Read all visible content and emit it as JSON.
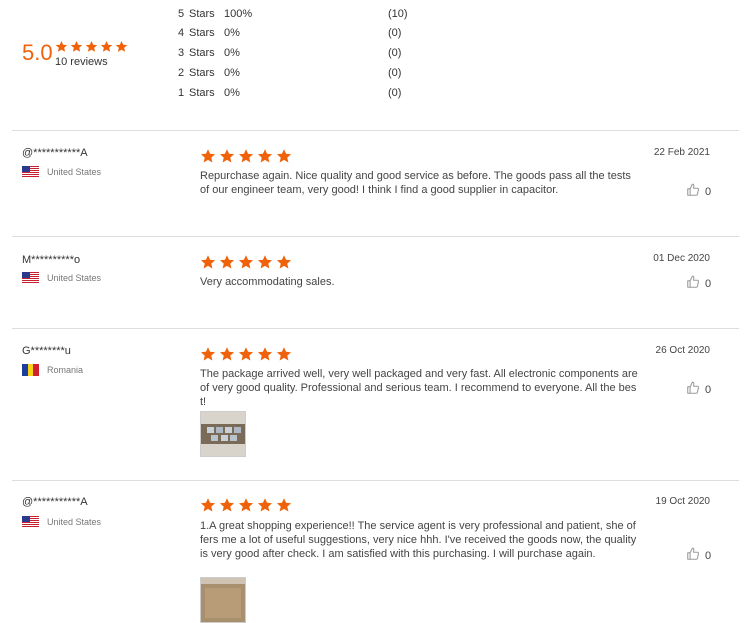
{
  "summary": {
    "average": "5.0",
    "count_label": "10 reviews",
    "histogram": [
      {
        "level": "5",
        "stars_label": "Stars",
        "percent": "100%",
        "count": "(10)"
      },
      {
        "level": "4",
        "stars_label": "Stars",
        "percent": "0%",
        "count": "(0)"
      },
      {
        "level": "3",
        "stars_label": "Stars",
        "percent": "0%",
        "count": "(0)"
      },
      {
        "level": "2",
        "stars_label": "Stars",
        "percent": "0%",
        "count": "(0)"
      },
      {
        "level": "1",
        "stars_label": "Stars",
        "percent": "0%",
        "count": "(0)"
      }
    ],
    "rating_stars": 5
  },
  "colors": {
    "accent": "#f0620a",
    "divider": "#dddddd"
  },
  "reviews": [
    {
      "name": "@***********A",
      "country": "United States",
      "flag": "us-flag",
      "rating": 5,
      "date": "22 Feb 2021",
      "text": "Repurchase again. Nice quality and good service as before. The goods pass all the tests of our engineer team, very good! I think I find a good supplier in capacitor.",
      "likes": "0"
    },
    {
      "name": "M**********o",
      "country": "United States",
      "flag": "us-flag",
      "rating": 5,
      "date": "01 Dec 2020",
      "text": "Very accommodating sales.",
      "likes": "0"
    },
    {
      "name": "G********u",
      "country": "Romania",
      "flag": "romania-flag",
      "rating": 5,
      "date": "26 Oct 2020",
      "text": "The package arrived well, very well packaged and very fast. All electronic components are of very good quality. Professional and serious team. I recommend to everyone. All the best!",
      "likes": "0",
      "has_photo": true
    },
    {
      "name": "@***********A",
      "country": "United States",
      "flag": "us-flag",
      "rating": 5,
      "date": "19 Oct 2020",
      "text": "1.A great shopping experience!! The service agent is very professional and patient, she offers me a lot of useful suggestions, very nice hhh. I've received the goods now, the quality is very good after check. I am satisfied with this purchasing. I will purchase again.",
      "likes": "0",
      "has_photo": true
    }
  ]
}
